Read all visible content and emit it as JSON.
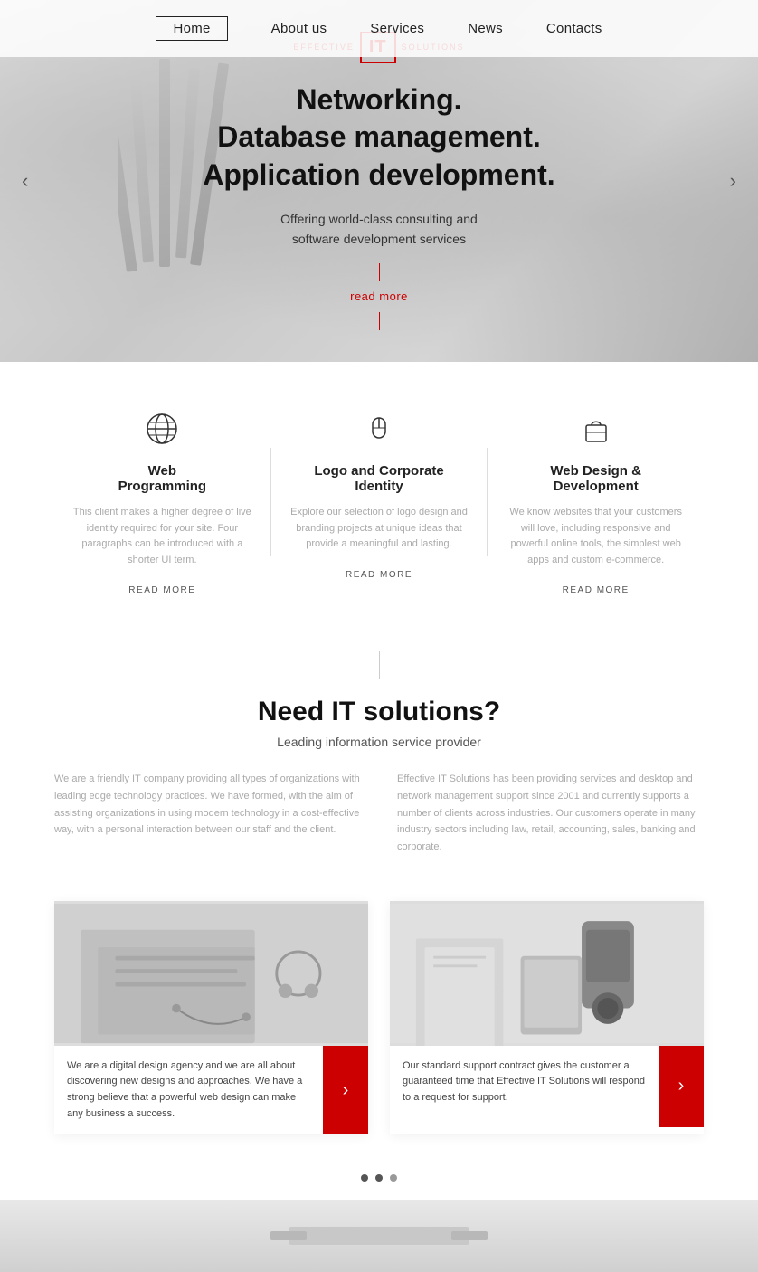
{
  "nav": {
    "items": [
      {
        "label": "Home",
        "active": true
      },
      {
        "label": "About us",
        "active": false
      },
      {
        "label": "Services",
        "active": false
      },
      {
        "label": "News",
        "active": false
      },
      {
        "label": "Contacts",
        "active": false
      }
    ]
  },
  "hero": {
    "logo": {
      "left": "EFFECTIVE",
      "center": "IT",
      "right": "SOLUTIONS"
    },
    "heading_line1": "Networking.",
    "heading_line2": "Database management.",
    "heading_line3": "Application development.",
    "subtext": "Offering world-class consulting and\nsoftware development services",
    "readmore": "read more",
    "arrow_left": "‹",
    "arrow_right": "›"
  },
  "services": {
    "items": [
      {
        "title": "Web\nProgramming",
        "description": "This client makes a higher degree of live identity required for your site. Four paragraphs can be introduced with a shorter UI term.",
        "readmore": "READ MORE",
        "icon": "globe"
      },
      {
        "title": "Logo and Corporate\nIdentity",
        "description": "Explore our selection of logo design and branding projects at unique ideas that provide a meaningful and lasting.",
        "readmore": "READ MORE",
        "icon": "mouse"
      },
      {
        "title": "Web Design &\nDevelopment",
        "description": "We know websites that your customers will love, including responsive and powerful online tools, the simplest web apps and custom e-commerce.",
        "readmore": "READ MORE",
        "icon": "bag"
      }
    ]
  },
  "need_it": {
    "heading": "Need IT solutions?",
    "subtitle": "Leading information service provider",
    "col1": "We are a friendly IT company providing all types of organizations with leading edge technology practices. We have formed, with the aim of assisting organizations in using modern technology in a cost-effective way, with a personal interaction between our staff and the client.",
    "col2": "Effective IT Solutions has been providing services and desktop and network management support since 2001 and currently supports a number of clients across industries. Our customers operate in many industry sectors including law, retail, accounting, sales, banking and corporate."
  },
  "cards": [
    {
      "text": "We are a digital design agency and we are all about discovering new designs and approaches. We have a strong believe that a powerful web design can make any business a success.",
      "bg_color": "#d8d8d8"
    },
    {
      "text": "Our standard support contract gives the customer a guaranteed time that Effective IT Solutions will respond to a request for support.",
      "bg_color": "#ccc"
    }
  ],
  "dots": [
    {
      "active": true
    },
    {
      "active": true
    },
    {
      "active": false
    }
  ],
  "colors": {
    "accent": "#cc0000",
    "dark": "#111111",
    "mid": "#555555",
    "light": "#aaaaaa"
  }
}
